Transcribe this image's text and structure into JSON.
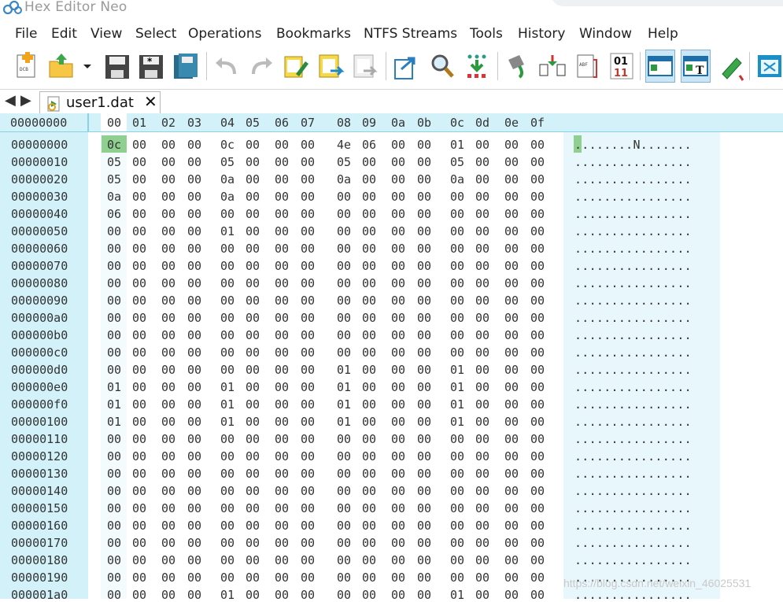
{
  "window": {
    "title": "Hex Editor Neo"
  },
  "menu": [
    "File",
    "Edit",
    "View",
    "Select",
    "Operations",
    "Bookmarks",
    "NTFS Streams",
    "Tools",
    "History",
    "Window",
    "Help"
  ],
  "toolbar": [
    {
      "name": "new-document-icon"
    },
    {
      "name": "open-folder-icon"
    },
    {
      "name": "open-dropdown-icon"
    },
    {
      "name": "save-icon"
    },
    {
      "name": "save-as-icon"
    },
    {
      "name": "save-all-icon"
    },
    {
      "name": "undo-icon"
    },
    {
      "name": "redo-icon"
    },
    {
      "name": "edit-patch-icon"
    },
    {
      "name": "paste-clipboard-icon"
    },
    {
      "name": "copy-clipboard-icon"
    },
    {
      "name": "export-icon"
    },
    {
      "name": "find-icon"
    },
    {
      "name": "find-next-icon"
    },
    {
      "name": "fill-icon"
    },
    {
      "name": "compare-icon"
    },
    {
      "name": "select-block-icon"
    },
    {
      "name": "binary-view-icon",
      "label_top": "01",
      "label_bottom": "11"
    },
    {
      "name": "hex-view-icon",
      "active": true
    },
    {
      "name": "text-view-icon",
      "active": true
    },
    {
      "name": "highlight-icon"
    },
    {
      "name": "fullscreen-icon"
    }
  ],
  "tabs": {
    "nav_back": "◀",
    "nav_forward": "▶",
    "document": "user1.dat",
    "close": "✕"
  },
  "hex": {
    "offset_header": "00000000",
    "columns": [
      "00",
      "01",
      "02",
      "03",
      "04",
      "05",
      "06",
      "07",
      "08",
      "09",
      "0a",
      "0b",
      "0c",
      "0d",
      "0e",
      "0f"
    ],
    "rows": [
      {
        "offset": "00000000",
        "bytes": [
          "0c",
          "00",
          "00",
          "00",
          "0c",
          "00",
          "00",
          "00",
          "4e",
          "06",
          "00",
          "00",
          "01",
          "00",
          "00",
          "00"
        ],
        "ascii": "........N......."
      },
      {
        "offset": "00000010",
        "bytes": [
          "05",
          "00",
          "00",
          "00",
          "05",
          "00",
          "00",
          "00",
          "05",
          "00",
          "00",
          "00",
          "05",
          "00",
          "00",
          "00"
        ],
        "ascii": "................"
      },
      {
        "offset": "00000020",
        "bytes": [
          "05",
          "00",
          "00",
          "00",
          "0a",
          "00",
          "00",
          "00",
          "0a",
          "00",
          "00",
          "00",
          "0a",
          "00",
          "00",
          "00"
        ],
        "ascii": "................"
      },
      {
        "offset": "00000030",
        "bytes": [
          "0a",
          "00",
          "00",
          "00",
          "0a",
          "00",
          "00",
          "00",
          "00",
          "00",
          "00",
          "00",
          "00",
          "00",
          "00",
          "00"
        ],
        "ascii": "................"
      },
      {
        "offset": "00000040",
        "bytes": [
          "06",
          "00",
          "00",
          "00",
          "00",
          "00",
          "00",
          "00",
          "00",
          "00",
          "00",
          "00",
          "00",
          "00",
          "00",
          "00"
        ],
        "ascii": "................"
      },
      {
        "offset": "00000050",
        "bytes": [
          "00",
          "00",
          "00",
          "00",
          "01",
          "00",
          "00",
          "00",
          "00",
          "00",
          "00",
          "00",
          "00",
          "00",
          "00",
          "00"
        ],
        "ascii": "................"
      },
      {
        "offset": "00000060",
        "bytes": [
          "00",
          "00",
          "00",
          "00",
          "00",
          "00",
          "00",
          "00",
          "00",
          "00",
          "00",
          "00",
          "00",
          "00",
          "00",
          "00"
        ],
        "ascii": "................"
      },
      {
        "offset": "00000070",
        "bytes": [
          "00",
          "00",
          "00",
          "00",
          "00",
          "00",
          "00",
          "00",
          "00",
          "00",
          "00",
          "00",
          "00",
          "00",
          "00",
          "00"
        ],
        "ascii": "................"
      },
      {
        "offset": "00000080",
        "bytes": [
          "00",
          "00",
          "00",
          "00",
          "00",
          "00",
          "00",
          "00",
          "00",
          "00",
          "00",
          "00",
          "00",
          "00",
          "00",
          "00"
        ],
        "ascii": "................"
      },
      {
        "offset": "00000090",
        "bytes": [
          "00",
          "00",
          "00",
          "00",
          "00",
          "00",
          "00",
          "00",
          "00",
          "00",
          "00",
          "00",
          "00",
          "00",
          "00",
          "00"
        ],
        "ascii": "................"
      },
      {
        "offset": "000000a0",
        "bytes": [
          "00",
          "00",
          "00",
          "00",
          "00",
          "00",
          "00",
          "00",
          "00",
          "00",
          "00",
          "00",
          "00",
          "00",
          "00",
          "00"
        ],
        "ascii": "................"
      },
      {
        "offset": "000000b0",
        "bytes": [
          "00",
          "00",
          "00",
          "00",
          "00",
          "00",
          "00",
          "00",
          "00",
          "00",
          "00",
          "00",
          "00",
          "00",
          "00",
          "00"
        ],
        "ascii": "................"
      },
      {
        "offset": "000000c0",
        "bytes": [
          "00",
          "00",
          "00",
          "00",
          "00",
          "00",
          "00",
          "00",
          "00",
          "00",
          "00",
          "00",
          "00",
          "00",
          "00",
          "00"
        ],
        "ascii": "................"
      },
      {
        "offset": "000000d0",
        "bytes": [
          "00",
          "00",
          "00",
          "00",
          "00",
          "00",
          "00",
          "00",
          "01",
          "00",
          "00",
          "00",
          "01",
          "00",
          "00",
          "00"
        ],
        "ascii": "................"
      },
      {
        "offset": "000000e0",
        "bytes": [
          "01",
          "00",
          "00",
          "00",
          "01",
          "00",
          "00",
          "00",
          "01",
          "00",
          "00",
          "00",
          "01",
          "00",
          "00",
          "00"
        ],
        "ascii": "................"
      },
      {
        "offset": "000000f0",
        "bytes": [
          "01",
          "00",
          "00",
          "00",
          "01",
          "00",
          "00",
          "00",
          "01",
          "00",
          "00",
          "00",
          "01",
          "00",
          "00",
          "00"
        ],
        "ascii": "................"
      },
      {
        "offset": "00000100",
        "bytes": [
          "01",
          "00",
          "00",
          "00",
          "01",
          "00",
          "00",
          "00",
          "01",
          "00",
          "00",
          "00",
          "01",
          "00",
          "00",
          "00"
        ],
        "ascii": "................"
      },
      {
        "offset": "00000110",
        "bytes": [
          "00",
          "00",
          "00",
          "00",
          "00",
          "00",
          "00",
          "00",
          "00",
          "00",
          "00",
          "00",
          "00",
          "00",
          "00",
          "00"
        ],
        "ascii": "................"
      },
      {
        "offset": "00000120",
        "bytes": [
          "00",
          "00",
          "00",
          "00",
          "00",
          "00",
          "00",
          "00",
          "00",
          "00",
          "00",
          "00",
          "00",
          "00",
          "00",
          "00"
        ],
        "ascii": "................"
      },
      {
        "offset": "00000130",
        "bytes": [
          "00",
          "00",
          "00",
          "00",
          "00",
          "00",
          "00",
          "00",
          "00",
          "00",
          "00",
          "00",
          "00",
          "00",
          "00",
          "00"
        ],
        "ascii": "................"
      },
      {
        "offset": "00000140",
        "bytes": [
          "00",
          "00",
          "00",
          "00",
          "00",
          "00",
          "00",
          "00",
          "00",
          "00",
          "00",
          "00",
          "00",
          "00",
          "00",
          "00"
        ],
        "ascii": "................"
      },
      {
        "offset": "00000150",
        "bytes": [
          "00",
          "00",
          "00",
          "00",
          "00",
          "00",
          "00",
          "00",
          "00",
          "00",
          "00",
          "00",
          "00",
          "00",
          "00",
          "00"
        ],
        "ascii": "................"
      },
      {
        "offset": "00000160",
        "bytes": [
          "00",
          "00",
          "00",
          "00",
          "00",
          "00",
          "00",
          "00",
          "00",
          "00",
          "00",
          "00",
          "00",
          "00",
          "00",
          "00"
        ],
        "ascii": "................"
      },
      {
        "offset": "00000170",
        "bytes": [
          "00",
          "00",
          "00",
          "00",
          "00",
          "00",
          "00",
          "00",
          "00",
          "00",
          "00",
          "00",
          "00",
          "00",
          "00",
          "00"
        ],
        "ascii": "................"
      },
      {
        "offset": "00000180",
        "bytes": [
          "00",
          "00",
          "00",
          "00",
          "00",
          "00",
          "00",
          "00",
          "00",
          "00",
          "00",
          "00",
          "00",
          "00",
          "00",
          "00"
        ],
        "ascii": "................"
      },
      {
        "offset": "00000190",
        "bytes": [
          "00",
          "00",
          "00",
          "00",
          "00",
          "00",
          "00",
          "00",
          "00",
          "00",
          "00",
          "00",
          "00",
          "00",
          "00",
          "00"
        ],
        "ascii": "................"
      },
      {
        "offset": "000001a0",
        "bytes": [
          "00",
          "00",
          "00",
          "00",
          "01",
          "00",
          "00",
          "00",
          "00",
          "00",
          "00",
          "00",
          "01",
          "00",
          "00",
          "00"
        ],
        "ascii": "................"
      }
    ]
  },
  "watermark": "https://blog.csdn.net/weixin_46025531",
  "colors": {
    "header_bg": "#d2f1f9",
    "cursor": "#8fcf8f",
    "ascii_bg": "#e8f7fc",
    "active_tool": "#cbe6f7"
  }
}
